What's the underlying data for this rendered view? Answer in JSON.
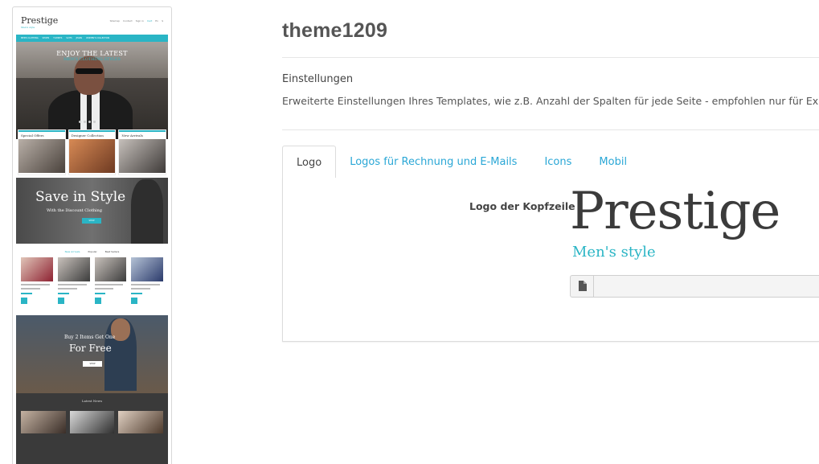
{
  "preview": {
    "logo": "Prestige",
    "logo_tagline": "Men's style",
    "top_links": [
      "Sitemap",
      "Contact",
      "Sign in",
      "Cart",
      "En",
      "$"
    ],
    "nav": [
      "MEN'S CLOTHING",
      "SHOES",
      "T-SHIRTS",
      "SUITS",
      "JEANS",
      "WOMEN'S COLLECTION"
    ],
    "hero_line1": "ENJOY THE LATEST",
    "hero_line2": "MEN'S CLOTHING STYLES",
    "tiles": [
      "Special Offers",
      "Designer Collection",
      "New Arrivals"
    ],
    "save_title": "Save in Style",
    "save_sub": "With the Discount Clothing",
    "save_btn": "SHOP",
    "product_tabs": [
      "New Arrivals",
      "Popular",
      "Best Sellers"
    ],
    "buy_line1": "Buy 2 Items Get One",
    "buy_line2": "For Free",
    "buy_btn": "SHOP",
    "news_title": "Latest News"
  },
  "main": {
    "title": "theme1209",
    "section_title": "Einstellungen",
    "section_desc": "Erweiterte Einstellungen Ihres Templates, wie z.B. Anzahl der Spalten für jede Seite - empfohlen nur für Experten!",
    "tabs": [
      {
        "label": "Logo",
        "active": true
      },
      {
        "label": "Logos für Rechnung und E-Mails",
        "active": false
      },
      {
        "label": "Icons",
        "active": false
      },
      {
        "label": "Mobil",
        "active": false
      }
    ],
    "field_label": "Logo der Kopfzeile",
    "logo_text": "Prestige",
    "logo_subtext": "Men's style",
    "file_value": ""
  },
  "colors": {
    "accent": "#2ab5c5",
    "link": "#2aa7d6",
    "text": "#444444"
  },
  "icons": {
    "file": "file-icon"
  }
}
